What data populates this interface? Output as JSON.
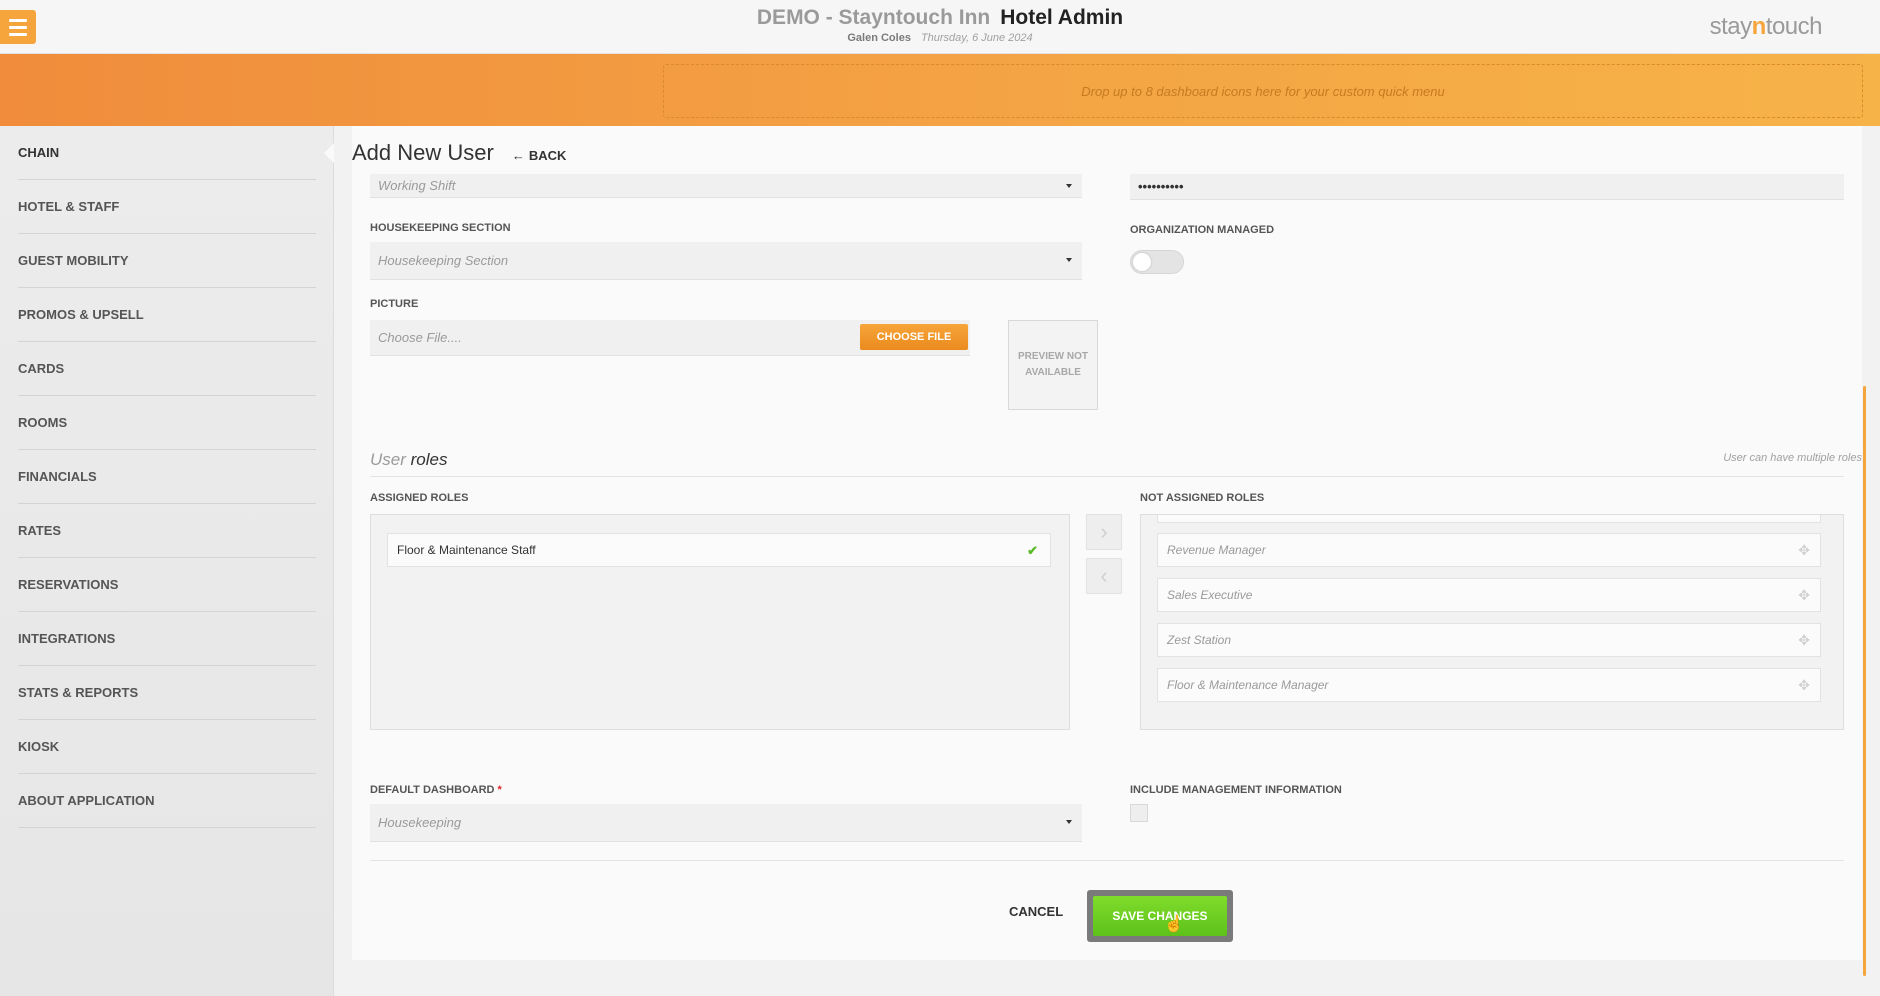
{
  "header": {
    "hotel_name": "DEMO - Stayntouch Inn",
    "app_title": "Hotel Admin",
    "user_name": "Galen Coles",
    "date": "Thursday, 6 June 2024",
    "logo_prefix": "stay",
    "logo_accent": "n",
    "logo_suffix": "touch"
  },
  "banner": {
    "dropzone_text": "Drop up to 8 dashboard icons here for your custom quick menu"
  },
  "sidebar": {
    "items": [
      {
        "label": "CHAIN"
      },
      {
        "label": "HOTEL & STAFF"
      },
      {
        "label": "GUEST MOBILITY"
      },
      {
        "label": "PROMOS & UPSELL"
      },
      {
        "label": "CARDS"
      },
      {
        "label": "ROOMS"
      },
      {
        "label": "FINANCIALS"
      },
      {
        "label": "RATES"
      },
      {
        "label": "RESERVATIONS"
      },
      {
        "label": "INTEGRATIONS"
      },
      {
        "label": "STATS & REPORTS"
      },
      {
        "label": "KIOSK"
      },
      {
        "label": "ABOUT APPLICATION"
      }
    ]
  },
  "page": {
    "title": "Add New User",
    "back_label": "BACK"
  },
  "form": {
    "working_shift_placeholder": "Working Shift",
    "password_value": "••••••••••",
    "housekeeping_label": "HOUSEKEEPING SECTION",
    "housekeeping_placeholder": "Housekeeping Section",
    "org_managed_label": "ORGANIZATION MANAGED",
    "org_managed_on": false,
    "picture_label": "PICTURE",
    "picture_placeholder": "Choose File....",
    "choose_file_label": "CHOOSE FILE",
    "preview_text": "PREVIEW NOT AVAILABLE",
    "default_dashboard_label": "DEFAULT DASHBOARD",
    "default_dashboard_value": "Housekeeping",
    "include_mgmt_label": "INCLUDE MANAGEMENT INFORMATION",
    "include_mgmt_checked": false
  },
  "roles": {
    "title_prefix": "User",
    "title_emph": "roles",
    "hint": "User can have multiple roles",
    "assigned_label": "ASSIGNED ROLES",
    "not_assigned_label": "NOT ASSIGNED ROLES",
    "assigned": [
      "Floor & Maintenance Staff"
    ],
    "not_assigned": [
      "Revenue Manager",
      "Sales Executive",
      "Zest Station",
      "Floor & Maintenance Manager"
    ]
  },
  "actions": {
    "cancel_label": "CANCEL",
    "save_label": "SAVE CHANGES"
  },
  "colors": {
    "accent": "#f5a53c",
    "save": "#6fd024",
    "check": "#5dbb2c",
    "required": "#d9262b"
  }
}
